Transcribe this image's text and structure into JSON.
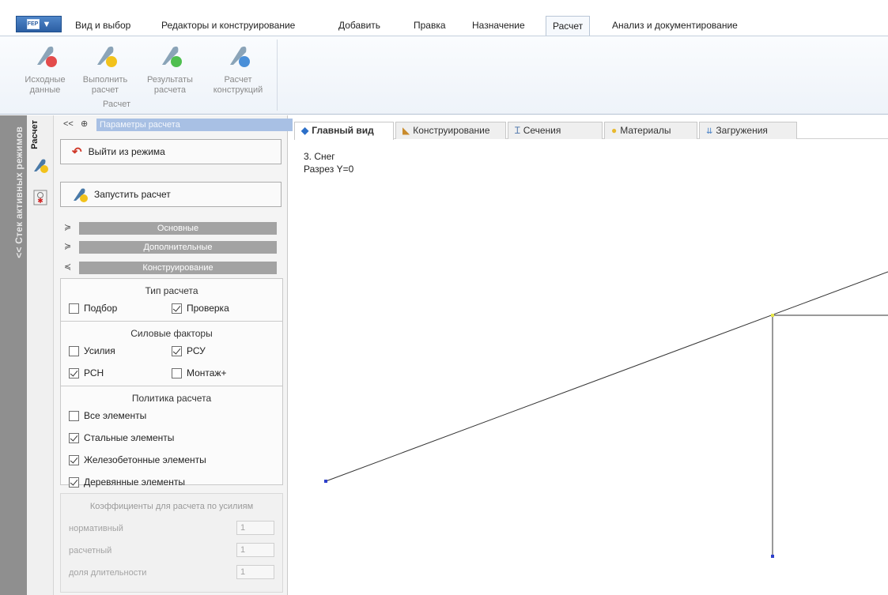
{
  "ribbon_tabs": {
    "app_label": "FEP",
    "items": [
      {
        "label": "Вид и выбор"
      },
      {
        "label": "Редакторы и конструирование"
      },
      {
        "label": "Добавить"
      },
      {
        "label": "Правка"
      },
      {
        "label": "Назначение"
      },
      {
        "label": "Расчет",
        "active": true
      },
      {
        "label": "Анализ и документирование"
      }
    ]
  },
  "ribbon": {
    "buttons": [
      {
        "label": "Исходные\nданные",
        "icon": "feather-red-dot-icon",
        "dot_color": "#e34b4b"
      },
      {
        "label": "Выполнить\nрасчет",
        "icon": "feather-yellow-dot-icon",
        "dot_color": "#f2c21b"
      },
      {
        "label": "Результаты\nрасчета",
        "icon": "feather-green-dot-icon",
        "dot_color": "#4fbf4f"
      },
      {
        "label": "Расчет\nконструкций",
        "icon": "feather-blue-dot-icon",
        "dot_color": "#4a8fd8"
      }
    ],
    "group_caption": "Расчет"
  },
  "left_strip": {
    "stack_label": "<< Стек активных режимов",
    "vertical_tab": "Расчет"
  },
  "panel": {
    "header_nav": "<<",
    "header_pin": "⊕",
    "header_title": "Параметры расчета",
    "exit_button": "Выйти из режима",
    "run_button": "Запустить расчет",
    "sections": [
      {
        "label": "Основные",
        "chevron": "≽"
      },
      {
        "label": "Дополнительные",
        "chevron": "≽"
      },
      {
        "label": "Конструирование",
        "chevron": "≼"
      }
    ],
    "calc_type": {
      "title": "Тип расчета",
      "options": [
        {
          "label": "Подбор",
          "checked": false
        },
        {
          "label": "Проверка",
          "checked": true
        }
      ]
    },
    "force_factors": {
      "title": "Силовые факторы",
      "options": [
        {
          "label": "Усилия",
          "checked": false
        },
        {
          "label": "РСУ",
          "checked": true
        },
        {
          "label": "РСН",
          "checked": true
        },
        {
          "label": "Монтаж+",
          "checked": false
        }
      ]
    },
    "policy": {
      "title": "Политика расчета",
      "options": [
        {
          "label": "Все элементы",
          "checked": false
        },
        {
          "label": "Стальные элементы",
          "checked": true
        },
        {
          "label": "Железобетонные элементы",
          "checked": true
        },
        {
          "label": "Деревянные элементы",
          "checked": true
        }
      ]
    },
    "coefficients": {
      "title": "Коэффициенты для расчета по усилиям",
      "rows": [
        {
          "label": "нормативный",
          "value": "1"
        },
        {
          "label": "расчетный",
          "value": "1"
        },
        {
          "label": "доля длительности",
          "value": "1"
        }
      ]
    }
  },
  "view_tabs": [
    {
      "label": "Главный вид",
      "icon": "pin-icon",
      "active": true
    },
    {
      "label": "Конструирование",
      "icon": "ruler-icon"
    },
    {
      "label": "Сечения",
      "icon": "ibeam-icon"
    },
    {
      "label": "Материалы",
      "icon": "material-icon"
    },
    {
      "label": "Загружения",
      "icon": "loads-icon"
    }
  ],
  "view": {
    "load_case": "3. Снег",
    "section": "Разрез Y=0"
  },
  "colors": {
    "accent": "#a8c0e4",
    "section_bar": "#a3a3a3",
    "node": "#2d3fcc",
    "node_highlight": "#e8e84a"
  }
}
